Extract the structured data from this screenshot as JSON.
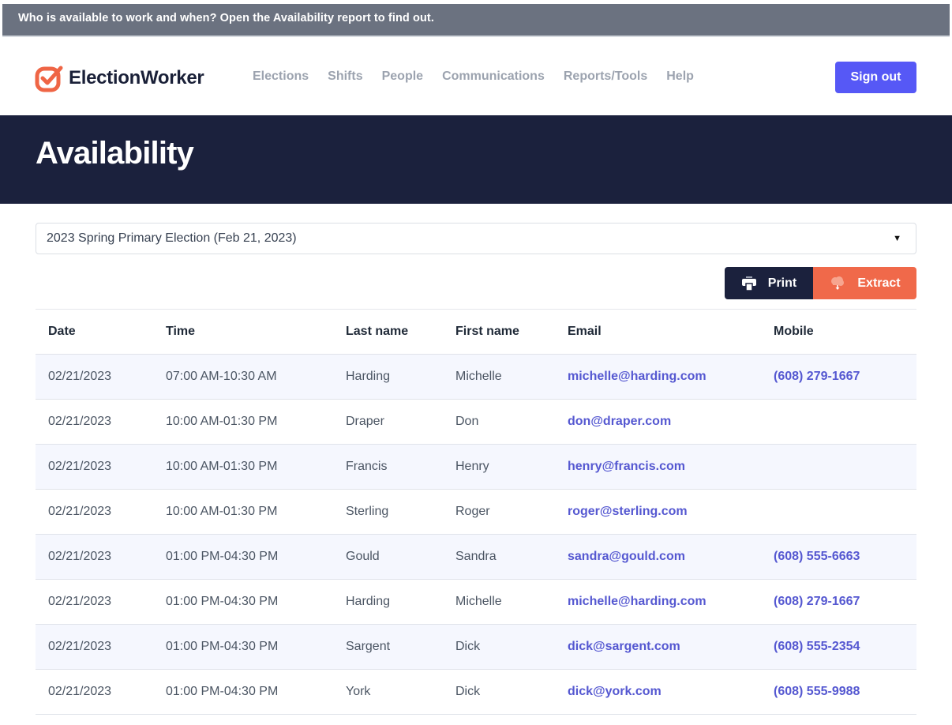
{
  "tip": {
    "text": "Who is available to work and when? Open the Availability report to find out."
  },
  "header": {
    "brand": "ElectionWorker",
    "brand_color": "#ef6545",
    "nav": [
      {
        "label": "Elections"
      },
      {
        "label": "Shifts"
      },
      {
        "label": "People"
      },
      {
        "label": "Communications"
      },
      {
        "label": "Reports/Tools"
      },
      {
        "label": "Help"
      }
    ],
    "signout_label": "Sign out",
    "signout_color": "#5658f6"
  },
  "page": {
    "title": "Availability"
  },
  "filter": {
    "election_selected": "2023 Spring Primary Election (Feb 21, 2023)",
    "caret_icon": "caret-down-icon"
  },
  "actions": {
    "print_label": "Print",
    "print_icon": "printer-icon",
    "extract_label": "Extract",
    "extract_icon": "cloud-download-icon"
  },
  "table": {
    "columns": [
      "Date",
      "Time",
      "Last name",
      "First name",
      "Email",
      "Mobile"
    ],
    "rows": [
      {
        "date": "02/21/2023",
        "time": "07:00 AM-10:30 AM",
        "last": "Harding",
        "first": "Michelle",
        "email": "michelle@harding.com",
        "mobile": "(608) 279-1667"
      },
      {
        "date": "02/21/2023",
        "time": "10:00 AM-01:30 PM",
        "last": "Draper",
        "first": "Don",
        "email": "don@draper.com",
        "mobile": ""
      },
      {
        "date": "02/21/2023",
        "time": "10:00 AM-01:30 PM",
        "last": "Francis",
        "first": "Henry",
        "email": "henry@francis.com",
        "mobile": ""
      },
      {
        "date": "02/21/2023",
        "time": "10:00 AM-01:30 PM",
        "last": "Sterling",
        "first": "Roger",
        "email": "roger@sterling.com",
        "mobile": ""
      },
      {
        "date": "02/21/2023",
        "time": "01:00 PM-04:30 PM",
        "last": "Gould",
        "first": "Sandra",
        "email": "sandra@gould.com",
        "mobile": "(608) 555-6663"
      },
      {
        "date": "02/21/2023",
        "time": "01:00 PM-04:30 PM",
        "last": "Harding",
        "first": "Michelle",
        "email": "michelle@harding.com",
        "mobile": "(608) 279-1667"
      },
      {
        "date": "02/21/2023",
        "time": "01:00 PM-04:30 PM",
        "last": "Sargent",
        "first": "Dick",
        "email": "dick@sargent.com",
        "mobile": "(608) 555-2354"
      },
      {
        "date": "02/21/2023",
        "time": "01:00 PM-04:30 PM",
        "last": "York",
        "first": "Dick",
        "email": "dick@york.com",
        "mobile": "(608) 555-9988"
      }
    ]
  }
}
